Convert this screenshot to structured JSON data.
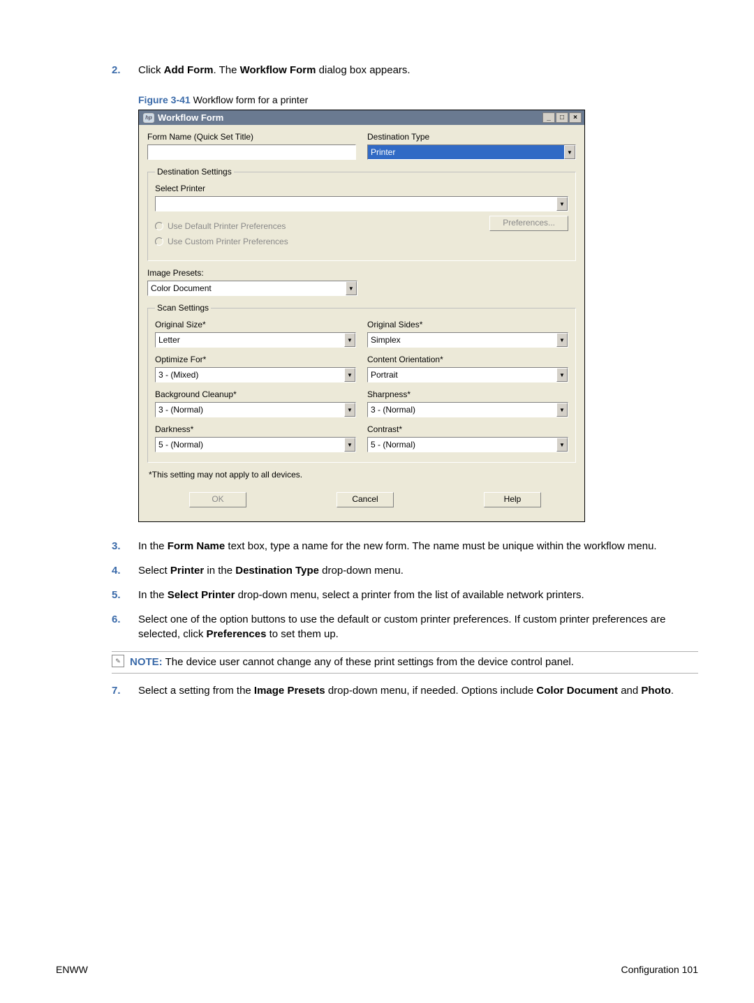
{
  "step2": {
    "num": "2.",
    "pre": "Click ",
    "b1": "Add Form",
    "mid": ". The ",
    "b2": "Workflow Form",
    "post": " dialog box appears."
  },
  "figure": {
    "label": "Figure 3-41",
    "caption": "  Workflow form for a printer"
  },
  "dialog": {
    "title": "Workflow Form",
    "hp": "hp",
    "win": {
      "min": "_",
      "max": "□",
      "close": "×"
    },
    "formNameLabel": "Form Name (Quick Set Title)",
    "destTypeLabel": "Destination Type",
    "destTypeValue": "Printer",
    "destSettingsLegend": "Destination Settings",
    "selectPrinterLabel": "Select Printer",
    "radioDefault": "Use Default Printer Preferences",
    "radioCustom": "Use Custom Printer Preferences",
    "prefBtn": "Preferences...",
    "imagePresetsLabel": "Image Presets:",
    "imagePresetsValue": "Color Document",
    "scanLegend": "Scan Settings",
    "origSizeLabel": "Original Size*",
    "origSizeValue": "Letter",
    "origSidesLabel": "Original Sides*",
    "origSidesValue": "Simplex",
    "optimizeLabel": "Optimize For*",
    "optimizeValue": "3 - (Mixed)",
    "orientLabel": "Content Orientation*",
    "orientValue": "Portrait",
    "bgLabel": "Background Cleanup*",
    "bgValue": "3 - (Normal)",
    "sharpLabel": "Sharpness*",
    "sharpValue": "3 - (Normal)",
    "darkLabel": "Darkness*",
    "darkValue": "5 - (Normal)",
    "contrastLabel": "Contrast*",
    "contrastValue": "5 - (Normal)",
    "footnote": "*This setting may not apply to all devices.",
    "okBtn": "OK",
    "cancelBtn": "Cancel",
    "helpBtn": "Help"
  },
  "step3": {
    "num": "3.",
    "pre": "In the ",
    "b1": "Form Name",
    "post": " text box, type a name for the new form. The name must be unique within the workflow menu."
  },
  "step4": {
    "num": "4.",
    "pre": "Select ",
    "b1": "Printer",
    "mid": " in the ",
    "b2": "Destination Type",
    "post": " drop-down menu."
  },
  "step5": {
    "num": "5.",
    "pre": "In the ",
    "b1": "Select Printer",
    "post": " drop-down menu, select a printer from the list of available network printers."
  },
  "step6": {
    "num": "6.",
    "pre": "Select one of the option buttons to use the default or custom printer preferences. If custom printer preferences are selected, click ",
    "b1": "Preferences",
    "post": " to set them up."
  },
  "note": {
    "label": "NOTE:",
    "text": "   The device user cannot change any of these print settings from the device control panel."
  },
  "step7": {
    "num": "7.",
    "pre": "Select a setting from the ",
    "b1": "Image Presets",
    "mid": " drop-down menu, if needed. Options include ",
    "b2": "Color Document",
    "mid2": " and ",
    "b3": "Photo",
    "post": "."
  },
  "footer": {
    "left": "ENWW",
    "rightLabel": "Configuration",
    "pageNum": "   101"
  }
}
